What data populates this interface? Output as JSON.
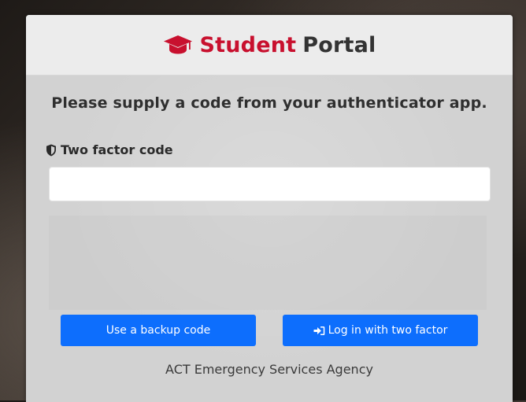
{
  "header": {
    "brand_primary": "Student",
    "brand_secondary": "Portal",
    "brand_icon": "graduation-cap-icon",
    "brand_primary_color": "#c8102e"
  },
  "instruction": "Please supply a code from your authenticator app.",
  "form": {
    "code_label": "Two factor code",
    "code_icon": "shield-icon",
    "code_value": "",
    "code_placeholder": ""
  },
  "buttons": {
    "backup_label": "Use a backup code",
    "login_label": "Log in with two factor",
    "login_icon": "sign-in-icon",
    "button_color": "#0d6efd"
  },
  "footer": {
    "text": "ACT Emergency Services Agency"
  }
}
